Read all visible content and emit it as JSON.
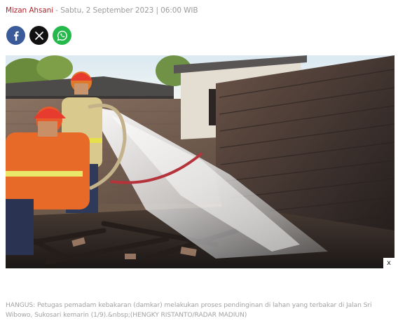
{
  "byline": {
    "author": "Mizan Ahsani",
    "separator": " - ",
    "date": "Sabtu, 2 September 2023 | 06:00 WIB"
  },
  "share": [
    {
      "name": "facebook",
      "icon": "facebook-icon",
      "color": "#3a5a99"
    },
    {
      "name": "x",
      "icon": "x-icon",
      "color": "#111111"
    },
    {
      "name": "whatsapp",
      "icon": "whatsapp-icon",
      "color": "#25b84b"
    }
  ],
  "photo": {
    "close_label": "x"
  },
  "caption": "HANGUS: Petugas pemadam kebakaran (damkar) melakukan proses pendinginan di lahan yang terbakar di Jalan Sri Wibowo, Sukosari kemarin (1/9).&nbsp;(HENGKY RISTANTO/RADAR MADIUN)"
}
